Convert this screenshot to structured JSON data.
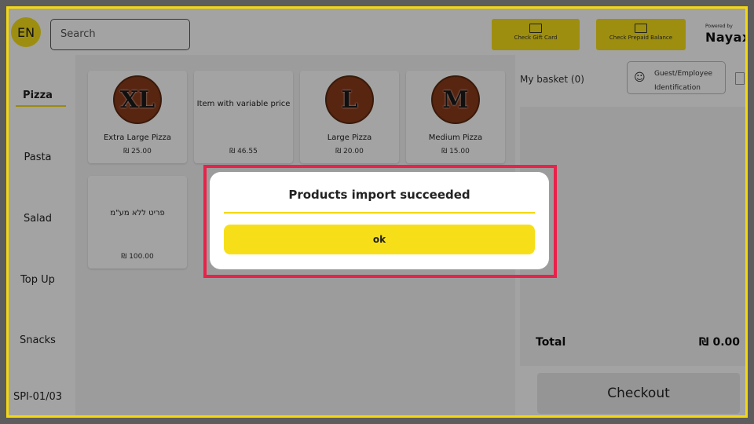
{
  "header": {
    "language": "EN",
    "search_placeholder": "Search",
    "gift_card_label": "Check Gift Card",
    "prepaid_label": "Check Prepaid Balance",
    "powered_by": "Powered by",
    "brand": "Nayax"
  },
  "sidebar": {
    "categories": [
      {
        "label": "Pizza"
      },
      {
        "label": "Pasta"
      },
      {
        "label": "Salad"
      },
      {
        "label": "Top Up"
      },
      {
        "label": "Snacks"
      }
    ],
    "footer": "SPI-01/03"
  },
  "products": [
    {
      "name": "Extra Large Pizza",
      "price": "₪ 25.00",
      "badge": "XL"
    },
    {
      "name": "Item with variable price",
      "price": "₪ 46.55",
      "badge": ""
    },
    {
      "name": "Large Pizza",
      "price": "₪ 20.00",
      "badge": "L"
    },
    {
      "name": "Medium Pizza",
      "price": "₪ 15.00",
      "badge": "M"
    },
    {
      "name": "פריט ללא מע\"מ",
      "price": "₪ 100.00",
      "badge": ""
    }
  ],
  "basket": {
    "title": "My basket (0)",
    "guest_line1": "Guest/Employee",
    "guest_line2": "Identification",
    "total_label": "Total",
    "total_value": "₪ 0.00",
    "checkout_label": "Checkout"
  },
  "dialog": {
    "title": "Products import succeeded",
    "ok_label": "ok"
  },
  "colors": {
    "accent": "#f6df19",
    "highlight": "#e8224a"
  }
}
